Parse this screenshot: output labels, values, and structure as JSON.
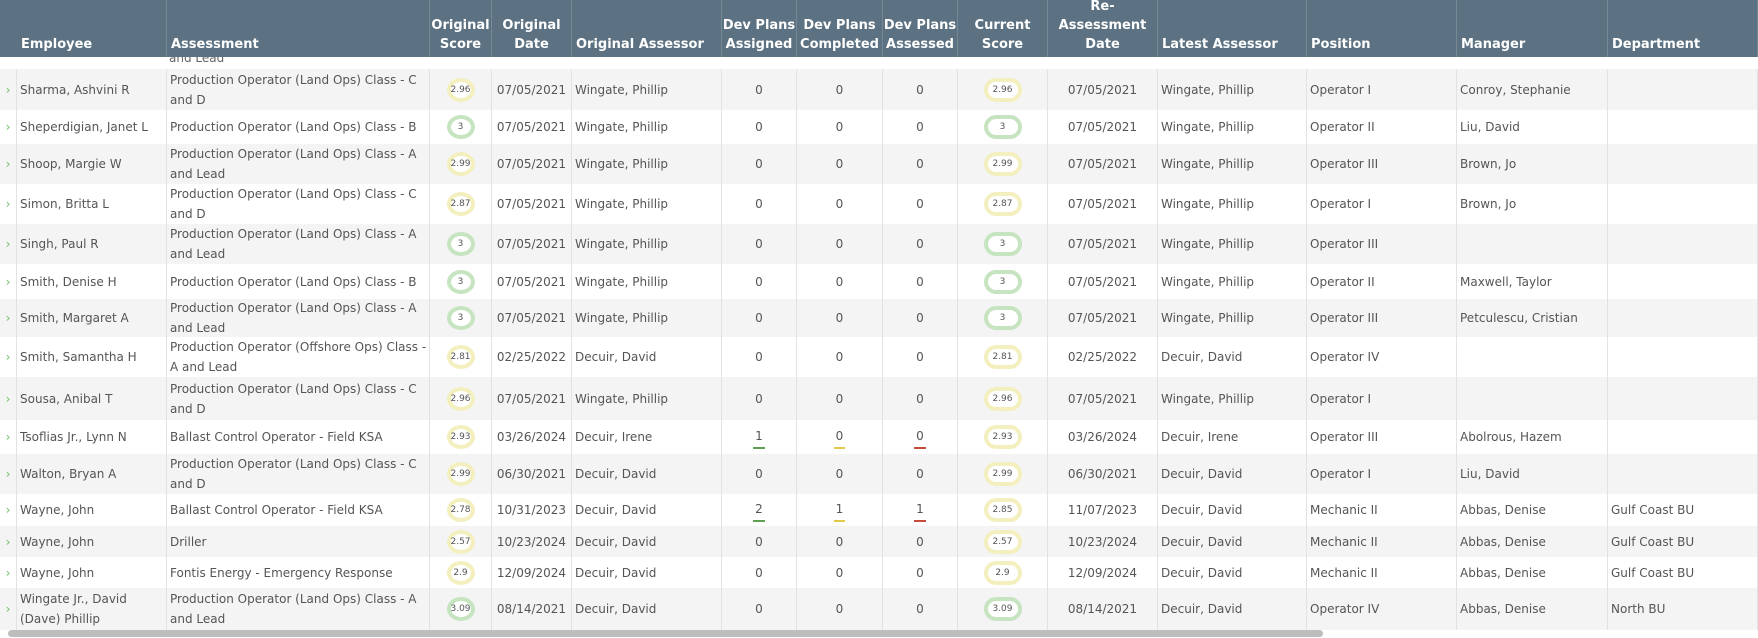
{
  "columns": [
    {
      "key": "employee",
      "label": "Employee",
      "align": "left"
    },
    {
      "key": "assessment",
      "label": "Assessment",
      "align": "left"
    },
    {
      "key": "orig_score",
      "label": "Original\nScore",
      "align": "center"
    },
    {
      "key": "orig_date",
      "label": "Original\nDate",
      "align": "center"
    },
    {
      "key": "orig_assessor",
      "label": "Original Assessor",
      "align": "left"
    },
    {
      "key": "dp_assigned",
      "label": "Dev Plans\nAssigned",
      "align": "center"
    },
    {
      "key": "dp_completed",
      "label": "Dev Plans\nCompleted",
      "align": "center"
    },
    {
      "key": "dp_assessed",
      "label": "Dev Plans\nAssessed",
      "align": "center"
    },
    {
      "key": "cur_score",
      "label": "Current\nScore",
      "align": "center"
    },
    {
      "key": "latest_date",
      "label": "Latest\nRe-Assessment\nDate",
      "align": "center"
    },
    {
      "key": "latest_assessor",
      "label": "Latest Assessor",
      "align": "left"
    },
    {
      "key": "position",
      "label": "Position",
      "align": "left"
    },
    {
      "key": "manager",
      "label": "Manager",
      "align": "left"
    },
    {
      "key": "department",
      "label": "Department",
      "align": "left"
    }
  ],
  "partial_row_text": "and Lead",
  "row_expand_glyph": "›",
  "rows": [
    {
      "employee": "Sharma, Ashvini R",
      "assessment": "Production Operator (Land Ops) Class - C and D",
      "orig_score": "2.96",
      "orig_color": "yellow",
      "orig_date": "07/05/2021",
      "orig_assessor": "Wingate, Phillip",
      "dp_assigned": "0",
      "dp_completed": "0",
      "dp_assessed": "0",
      "cur_score": "2.96",
      "cur_color": "yellow",
      "latest_date": "07/05/2021",
      "latest_assessor": "Wingate, Phillip",
      "position": "Operator I",
      "manager": "Conroy, Stephanie",
      "department": ""
    },
    {
      "employee": "Sheperdigian, Janet L",
      "assessment": "Production Operator (Land Ops) Class - B",
      "orig_score": "3",
      "orig_color": "green",
      "orig_date": "07/05/2021",
      "orig_assessor": "Wingate, Phillip",
      "dp_assigned": "0",
      "dp_completed": "0",
      "dp_assessed": "0",
      "cur_score": "3",
      "cur_color": "green",
      "latest_date": "07/05/2021",
      "latest_assessor": "Wingate, Phillip",
      "position": "Operator II",
      "manager": "Liu, David",
      "department": ""
    },
    {
      "employee": "Shoop, Margie W",
      "assessment": "Production Operator (Land Ops) Class - A and Lead",
      "orig_score": "2.99",
      "orig_color": "yellow",
      "orig_date": "07/05/2021",
      "orig_assessor": "Wingate, Phillip",
      "dp_assigned": "0",
      "dp_completed": "0",
      "dp_assessed": "0",
      "cur_score": "2.99",
      "cur_color": "yellow",
      "latest_date": "07/05/2021",
      "latest_assessor": "Wingate, Phillip",
      "position": "Operator III",
      "manager": "Brown, Jo",
      "department": ""
    },
    {
      "employee": "Simon, Britta L",
      "assessment": "Production Operator (Land Ops) Class - C and D",
      "orig_score": "2.87",
      "orig_color": "yellow",
      "orig_date": "07/05/2021",
      "orig_assessor": "Wingate, Phillip",
      "dp_assigned": "0",
      "dp_completed": "0",
      "dp_assessed": "0",
      "cur_score": "2.87",
      "cur_color": "yellow",
      "latest_date": "07/05/2021",
      "latest_assessor": "Wingate, Phillip",
      "position": "Operator I",
      "manager": "Brown, Jo",
      "department": ""
    },
    {
      "employee": "Singh, Paul R",
      "assessment": "Production Operator (Land Ops) Class - A and Lead",
      "orig_score": "3",
      "orig_color": "green",
      "orig_date": "07/05/2021",
      "orig_assessor": "Wingate, Phillip",
      "dp_assigned": "0",
      "dp_completed": "0",
      "dp_assessed": "0",
      "cur_score": "3",
      "cur_color": "green",
      "latest_date": "07/05/2021",
      "latest_assessor": "Wingate, Phillip",
      "position": "Operator III",
      "manager": "",
      "department": ""
    },
    {
      "employee": "Smith, Denise H",
      "assessment": "Production Operator (Land Ops) Class - B",
      "orig_score": "3",
      "orig_color": "green",
      "orig_date": "07/05/2021",
      "orig_assessor": "Wingate, Phillip",
      "dp_assigned": "0",
      "dp_completed": "0",
      "dp_assessed": "0",
      "cur_score": "3",
      "cur_color": "green",
      "latest_date": "07/05/2021",
      "latest_assessor": "Wingate, Phillip",
      "position": "Operator II",
      "manager": "Maxwell, Taylor",
      "department": ""
    },
    {
      "employee": "Smith, Margaret A",
      "assessment": "Production Operator (Land Ops) Class - A and Lead",
      "orig_score": "3",
      "orig_color": "green",
      "orig_date": "07/05/2021",
      "orig_assessor": "Wingate, Phillip",
      "dp_assigned": "0",
      "dp_completed": "0",
      "dp_assessed": "0",
      "cur_score": "3",
      "cur_color": "green",
      "latest_date": "07/05/2021",
      "latest_assessor": "Wingate, Phillip",
      "position": "Operator III",
      "manager": "Petculescu, Cristian",
      "department": ""
    },
    {
      "employee": "Smith, Samantha H",
      "assessment": "Production Operator (Offshore Ops) Class - A and Lead",
      "orig_score": "2.81",
      "orig_color": "yellow",
      "orig_date": "02/25/2022",
      "orig_assessor": "Decuir, David",
      "dp_assigned": "0",
      "dp_completed": "0",
      "dp_assessed": "0",
      "cur_score": "2.81",
      "cur_color": "yellow",
      "latest_date": "02/25/2022",
      "latest_assessor": "Decuir, David",
      "position": "Operator IV",
      "manager": "",
      "department": ""
    },
    {
      "employee": "Sousa, Anibal T",
      "assessment": "Production Operator (Land Ops) Class - C and D",
      "orig_score": "2.96",
      "orig_color": "yellow",
      "orig_date": "07/05/2021",
      "orig_assessor": "Wingate, Phillip",
      "dp_assigned": "0",
      "dp_completed": "0",
      "dp_assessed": "0",
      "cur_score": "2.96",
      "cur_color": "yellow",
      "latest_date": "07/05/2021",
      "latest_assessor": "Wingate, Phillip",
      "position": "Operator I",
      "manager": "",
      "department": ""
    },
    {
      "employee": "Tsoflias Jr., Lynn N",
      "assessment": "Ballast Control Operator - Field KSA",
      "orig_score": "2.93",
      "orig_color": "yellow",
      "orig_date": "03/26/2024",
      "orig_assessor": "Decuir, Irene",
      "dp_assigned": "1",
      "dp_completed": "0",
      "dp_assessed": "0",
      "dp_underline": true,
      "cur_score": "2.93",
      "cur_color": "yellow",
      "latest_date": "03/26/2024",
      "latest_assessor": "Decuir, Irene",
      "position": "Operator III",
      "manager": "Abolrous, Hazem",
      "department": ""
    },
    {
      "employee": "Walton, Bryan A",
      "assessment": "Production Operator (Land Ops) Class - C and D",
      "orig_score": "2.99",
      "orig_color": "yellow",
      "orig_date": "06/30/2021",
      "orig_assessor": "Decuir, David",
      "dp_assigned": "0",
      "dp_completed": "0",
      "dp_assessed": "0",
      "cur_score": "2.99",
      "cur_color": "yellow",
      "latest_date": "06/30/2021",
      "latest_assessor": "Decuir, David",
      "position": "Operator I",
      "manager": "Liu, David",
      "department": ""
    },
    {
      "employee": "Wayne, John",
      "assessment": "Ballast Control Operator - Field KSA",
      "orig_score": "2.78",
      "orig_color": "yellow",
      "orig_date": "10/31/2023",
      "orig_assessor": "Decuir, David",
      "dp_assigned": "2",
      "dp_completed": "1",
      "dp_assessed": "1",
      "dp_underline": true,
      "cur_score": "2.85",
      "cur_color": "yellow",
      "latest_date": "11/07/2023",
      "latest_assessor": "Decuir, David",
      "position": "Mechanic II",
      "manager": "Abbas, Denise",
      "department": "Gulf Coast BU"
    },
    {
      "employee": "Wayne, John",
      "assessment": "Driller",
      "orig_score": "2.57",
      "orig_color": "yellow",
      "orig_date": "10/23/2024",
      "orig_assessor": "Decuir, David",
      "dp_assigned": "0",
      "dp_completed": "0",
      "dp_assessed": "0",
      "cur_score": "2.57",
      "cur_color": "yellow",
      "latest_date": "10/23/2024",
      "latest_assessor": "Decuir, David",
      "position": "Mechanic II",
      "manager": "Abbas, Denise",
      "department": "Gulf Coast BU"
    },
    {
      "employee": "Wayne, John",
      "assessment": "Fontis Energy - Emergency Response",
      "orig_score": "2.9",
      "orig_color": "yellow",
      "orig_date": "12/09/2024",
      "orig_assessor": "Decuir, David",
      "dp_assigned": "0",
      "dp_completed": "0",
      "dp_assessed": "0",
      "cur_score": "2.9",
      "cur_color": "yellow",
      "latest_date": "12/09/2024",
      "latest_assessor": "Decuir, David",
      "position": "Mechanic II",
      "manager": "Abbas, Denise",
      "department": "Gulf Coast BU"
    },
    {
      "employee": "Wingate Jr., David (Dave) Phillip",
      "assessment": "Production Operator (Land Ops) Class - A and Lead",
      "orig_score": "3.09",
      "orig_color": "green",
      "orig_date": "08/14/2021",
      "orig_assessor": "Decuir, David",
      "dp_assigned": "0",
      "dp_completed": "0",
      "dp_assessed": "0",
      "cur_score": "3.09",
      "cur_color": "green",
      "latest_date": "08/14/2021",
      "latest_assessor": "Decuir, David",
      "position": "Operator IV",
      "manager": "Abbas, Denise",
      "department": "North BU"
    }
  ]
}
